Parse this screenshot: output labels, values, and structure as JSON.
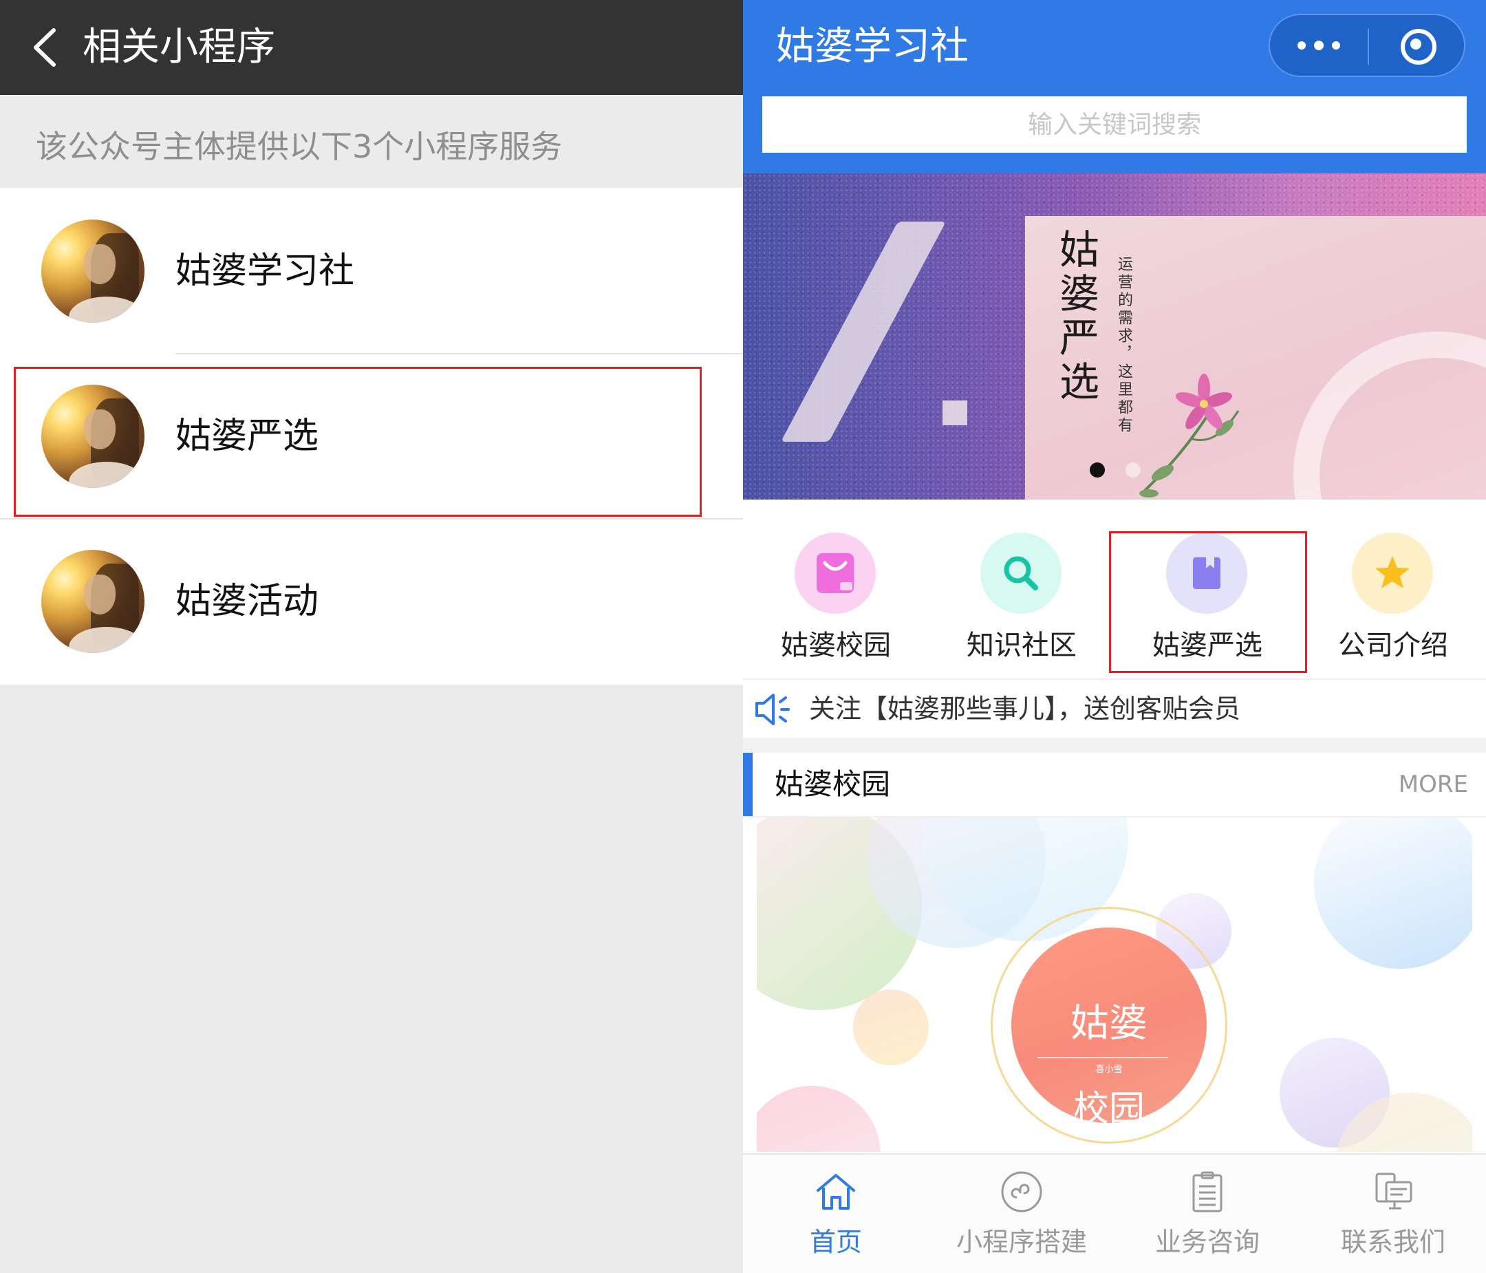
{
  "left": {
    "title": "相关小程序",
    "subtitle": "该公众号主体提供以下3个小程序服务",
    "items": [
      {
        "name": "姑婆学习社"
      },
      {
        "name": "姑婆严选"
      },
      {
        "name": "姑婆活动"
      }
    ]
  },
  "right": {
    "app_title": "姑婆学习社",
    "search_placeholder": "输入关键词搜索",
    "banner": {
      "title": "姑婆严选",
      "slogan": "运营的需求，这里都有"
    },
    "grid": [
      {
        "label": "姑婆校园",
        "icon": "shopping-bag-icon",
        "bg": "#fbd2f2",
        "fg": "#f06de0"
      },
      {
        "label": "知识社区",
        "icon": "search-icon",
        "bg": "#d8f8f2",
        "fg": "#17c5a5"
      },
      {
        "label": "姑婆严选",
        "icon": "bookmark-book-icon",
        "bg": "#e4e2fb",
        "fg": "#8a7ff0"
      },
      {
        "label": "公司介绍",
        "icon": "star-icon",
        "bg": "#fdf0c9",
        "fg": "#fbbf1d"
      }
    ],
    "notice": "关注【姑婆那些事儿】，送创客贴会员",
    "section": {
      "title": "姑婆校园",
      "more": "MORE"
    },
    "campus_emblem": {
      "line1": "姑婆",
      "small": "喜小雪",
      "line2": "校园"
    },
    "tabs": [
      {
        "label": "首页",
        "icon": "home-icon",
        "active": true
      },
      {
        "label": "小程序搭建",
        "icon": "mini-program-icon",
        "active": false
      },
      {
        "label": "业务咨询",
        "icon": "clipboard-list-icon",
        "active": false
      },
      {
        "label": "联系我们",
        "icon": "contact-devices-icon",
        "active": false
      }
    ],
    "colors": {
      "primary": "#2f7ae5",
      "inactive_tab": "#999999",
      "highlight_box": "#e02020"
    }
  }
}
